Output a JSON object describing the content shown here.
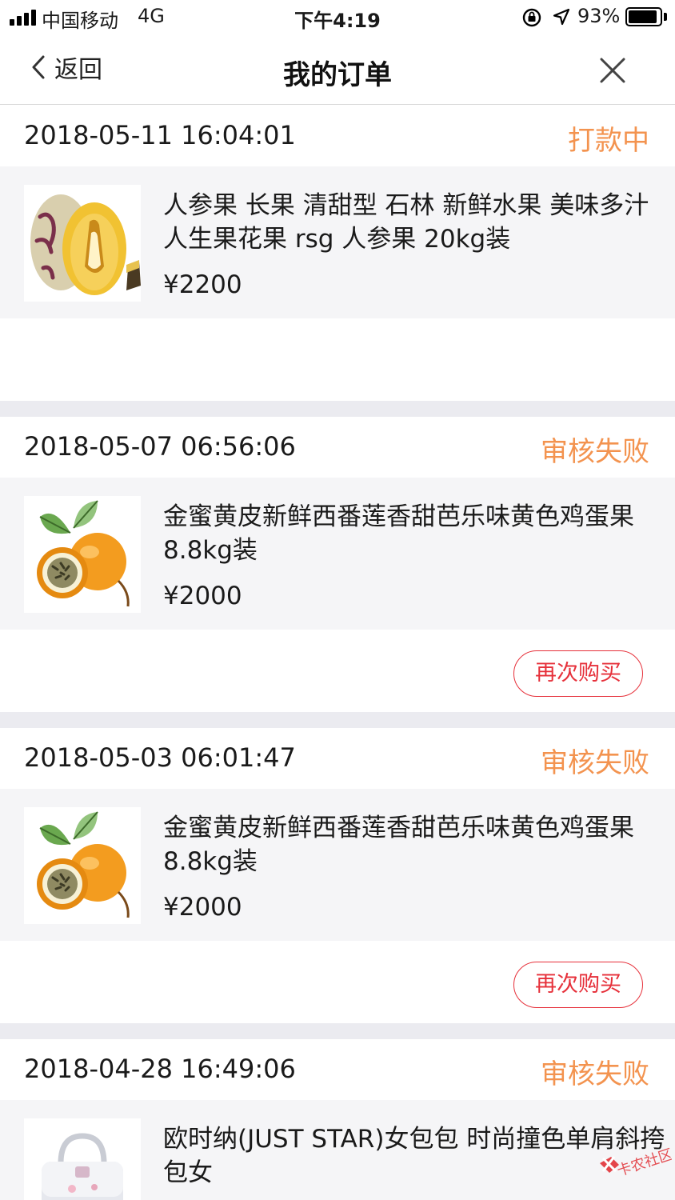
{
  "status_bar": {
    "carrier": "中国移动",
    "network": "4G",
    "time": "下午4:19",
    "battery": "93%",
    "battery_level": 0.93
  },
  "nav": {
    "back_label": "返回",
    "title": "我的订单"
  },
  "colors": {
    "status": "#f3934f",
    "rebuy": "#e6303a",
    "item_bg": "#f5f5f7",
    "gap": "#ebebf0"
  },
  "orders": [
    {
      "date": "2018-05-11 16:04:01",
      "status": "打款中",
      "title": "人参果 长果 清甜型 石林 新鲜水果 美味多汁 人生果花果 rsg 人参果 20kg装",
      "price": "¥2200",
      "image": "pepino-melon-image",
      "action": ""
    },
    {
      "date": "2018-05-07 06:56:06",
      "status": "审核失败",
      "title": "金蜜黄皮新鲜西番莲香甜芭乐味黄色鸡蛋果 8.8kg装",
      "price": "¥2000",
      "image": "passion-fruit-image",
      "action": "再次购买"
    },
    {
      "date": "2018-05-03 06:01:47",
      "status": "审核失败",
      "title": "金蜜黄皮新鲜西番莲香甜芭乐味黄色鸡蛋果 8.8kg装",
      "price": "¥2000",
      "image": "passion-fruit-image",
      "action": "再次购买"
    },
    {
      "date": "2018-04-28 16:49:06",
      "status": "审核失败",
      "title": "欧时纳(JUST STAR)女包包 时尚撞色单肩斜挎包女",
      "price": "",
      "image": "handbag-image",
      "action": ""
    }
  ],
  "watermark": "卡农社区"
}
